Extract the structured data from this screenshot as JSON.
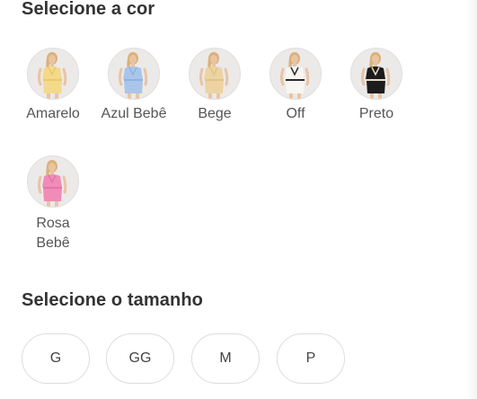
{
  "color_section": {
    "title": "Selecione a cor",
    "options": [
      {
        "label": "Amarelo",
        "dress_color": "#f3d98a",
        "accent": "#e8c96e"
      },
      {
        "label": "Azul Bebê",
        "dress_color": "#a9c6ea",
        "accent": "#8fb3e0"
      },
      {
        "label": "Bege",
        "dress_color": "#ecd3a1",
        "accent": "#dfc48d"
      },
      {
        "label": "Off",
        "dress_color": "#f7f6f2",
        "accent": "#2a2a2a"
      },
      {
        "label": "Preto",
        "dress_color": "#1c1c1c",
        "accent": "#e8dcc0"
      },
      {
        "label": "Rosa Bebê",
        "dress_color": "#f08cb8",
        "accent": "#e774a6"
      }
    ]
  },
  "size_section": {
    "title": "Selecione o tamanho",
    "options": [
      "G",
      "GG",
      "M",
      "P"
    ]
  }
}
